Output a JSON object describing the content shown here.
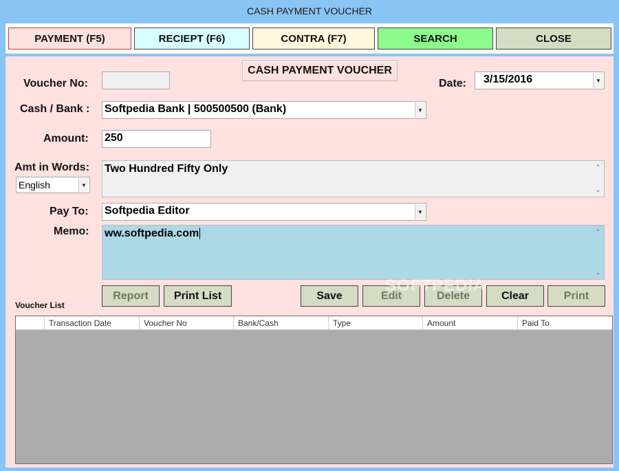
{
  "window": {
    "title": "CASH PAYMENT VOUCHER"
  },
  "tabs": {
    "payment": "PAYMENT (F5)",
    "receipt": "RECIEPT (F6)",
    "contra": "CONTRA (F7)",
    "search": "SEARCH",
    "close": "CLOSE"
  },
  "form": {
    "heading": "CASH PAYMENT VOUCHER",
    "voucher_no_label": "Voucher No:",
    "voucher_no_value": "",
    "date_label": "Date:",
    "date_value": "3/15/2016",
    "cash_bank_label": "Cash / Bank :",
    "cash_bank_value": "Softpedia Bank | 500500500 (Bank)",
    "amount_label": "Amount:",
    "amount_value": "250",
    "amt_words_label": "Amt in Words:",
    "amt_words_value": "Two Hundred Fifty Only",
    "language_value": "English",
    "pay_to_label": "Pay To:",
    "pay_to_value": "Softpedia Editor",
    "memo_label": "Memo:",
    "memo_value": "ww.softpedia.com"
  },
  "buttons": {
    "report": "Report",
    "print_list": "Print List",
    "save": "Save",
    "edit": "Edit",
    "delete": "Delete",
    "clear": "Clear",
    "print": "Print"
  },
  "voucher_list": {
    "label": "Voucher List",
    "columns": [
      "Transaction Date",
      "Voucher No",
      "Bank/Cash",
      "Type",
      "Amount",
      "Paid To"
    ]
  },
  "watermark": "SOFTPEDIA",
  "colors": {
    "title_bar": "#88c4f4",
    "form_bg": "#ffe1e0",
    "memo_bg": "#add8e6",
    "search_tab": "#8cfa8c",
    "button_bg": "#d6dcc4",
    "grid_bg": "#ababab"
  }
}
